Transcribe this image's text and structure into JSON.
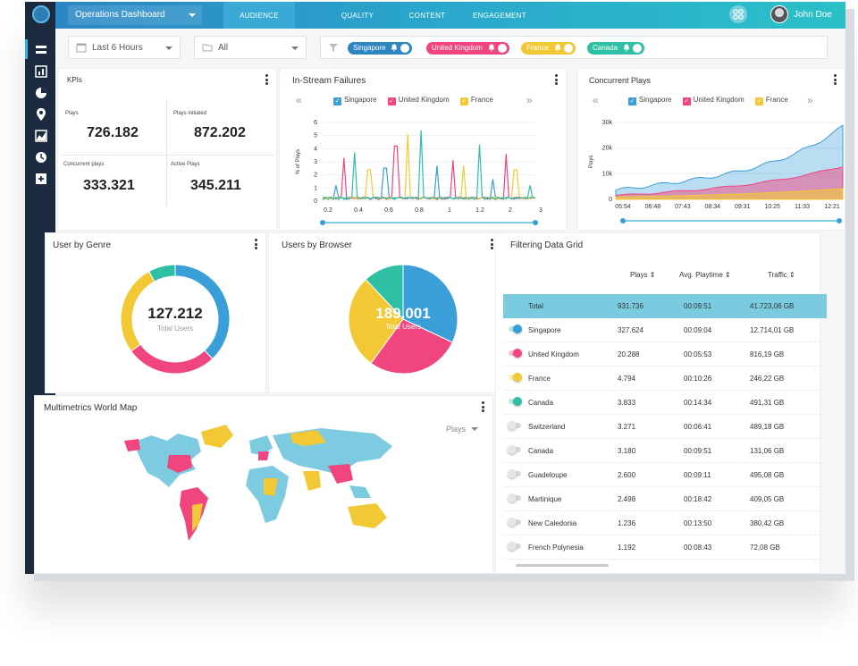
{
  "header": {
    "dashboard_select": "Operations Dashboard",
    "tabs": [
      "AUDIENCE",
      "QUALITY",
      "CONTENT",
      "ENGAGEMENT"
    ],
    "active_tab": "AUDIENCE",
    "username": "John Doe"
  },
  "filters": {
    "time_range": "Last 6 Hours",
    "segment": "All",
    "chips": [
      {
        "label": "Singapore",
        "color": "#2e86c1"
      },
      {
        "label": "United Kingdom",
        "color": "#f0457e"
      },
      {
        "label": "France",
        "color": "#f2c935"
      },
      {
        "label": "Canada",
        "color": "#2fbfa5"
      }
    ]
  },
  "colors": {
    "singapore": "#3a9fd8",
    "uk": "#f0457e",
    "france": "#f2c935",
    "canada": "#2fbfa5",
    "sidebar": "#1b2a3f",
    "accent": "#2aa8cc"
  },
  "kpis": {
    "title": "KPIs",
    "items": [
      {
        "label": "Plays",
        "value": "726.182"
      },
      {
        "label": "Plays initiated",
        "value": "872.202"
      },
      {
        "label": "Concurrent plays",
        "value": "333.321"
      },
      {
        "label": "Active Plays",
        "value": "345.211"
      }
    ]
  },
  "failures": {
    "title": "In-Stream Failures",
    "legend": [
      "Singapore",
      "United Kingdom",
      "France"
    ],
    "ylabel": "% of Plays",
    "y_ticks": [
      "6",
      "5",
      "4",
      "3",
      "2",
      "1",
      "0"
    ],
    "x_ticks": [
      "0.2",
      "0.4",
      "0.6",
      "0.8",
      "1",
      "1.2",
      "2",
      "3"
    ]
  },
  "concurrent": {
    "title": "Concurrent Plays",
    "legend": [
      "Singapore",
      "United Kingdom",
      "France"
    ],
    "ylabel": "Plays",
    "y_ticks": [
      "30k",
      "20k",
      "10k",
      "0"
    ],
    "x_ticks": [
      "05:54",
      "06:48",
      "07:43",
      "08:34",
      "09:31",
      "10:25",
      "11:33",
      "12:21"
    ]
  },
  "genre": {
    "title": "User by Genre",
    "value": "127.212",
    "label": "Total Users",
    "slices": [
      {
        "value": 38,
        "color": "#3a9fd8"
      },
      {
        "value": 27,
        "color": "#f0457e"
      },
      {
        "value": 27,
        "color": "#f2c935"
      },
      {
        "value": 8,
        "color": "#2fbfa5"
      }
    ]
  },
  "browser": {
    "title": "Users by Browser",
    "value": "189.001",
    "label": "Total Users",
    "slices": [
      {
        "value": 32,
        "color": "#3a9fd8"
      },
      {
        "value": 28,
        "color": "#f0457e"
      },
      {
        "value": 28,
        "color": "#f2c935"
      },
      {
        "value": 12,
        "color": "#2fbfa5"
      }
    ]
  },
  "map": {
    "title": "Multimetrics World Map",
    "metric_select": "Plays"
  },
  "grid": {
    "title": "Filtering Data Grid",
    "columns": [
      "Plays",
      "Avg. Playtime",
      "Traffic"
    ],
    "total": {
      "name": "Total",
      "plays": "931.736",
      "playtime": "00:09:51",
      "traffic": "41.723,06 GB"
    },
    "rows": [
      {
        "name": "Singapore",
        "plays": "327.624",
        "playtime": "00:09:04",
        "traffic": "12.714,01 GB",
        "on": true,
        "color": "#3a9fd8"
      },
      {
        "name": "United Kingdom",
        "plays": "20.288",
        "playtime": "00:05:53",
        "traffic": "816,19 GB",
        "on": true,
        "color": "#f0457e"
      },
      {
        "name": "France",
        "plays": "4.794",
        "playtime": "00:10:26",
        "traffic": "246,22 GB",
        "on": true,
        "color": "#f2c935"
      },
      {
        "name": "Canada",
        "plays": "3.833",
        "playtime": "00:14:34",
        "traffic": "491,31 GB",
        "on": true,
        "color": "#2fbfa5"
      },
      {
        "name": "Switzerland",
        "plays": "3.271",
        "playtime": "00:06:41",
        "traffic": "489,18 GB",
        "on": false,
        "color": "#e6e6e6"
      },
      {
        "name": "Canada",
        "plays": "3.180",
        "playtime": "00:09:51",
        "traffic": "131,06 GB",
        "on": false,
        "color": "#e6e6e6"
      },
      {
        "name": "Guadeloupe",
        "plays": "2.600",
        "playtime": "00:09:11",
        "traffic": "495,08 GB",
        "on": false,
        "color": "#e6e6e6"
      },
      {
        "name": "Martinique",
        "plays": "2.498",
        "playtime": "00:18:42",
        "traffic": "409,05 GB",
        "on": false,
        "color": "#e6e6e6"
      },
      {
        "name": "New Caledonia",
        "plays": "1.236",
        "playtime": "00:13:50",
        "traffic": "380,42 GB",
        "on": false,
        "color": "#e6e6e6"
      },
      {
        "name": "French Polynesia",
        "plays": "1.192",
        "playtime": "00:08:43",
        "traffic": "72,08 GB",
        "on": false,
        "color": "#e6e6e6"
      }
    ]
  }
}
